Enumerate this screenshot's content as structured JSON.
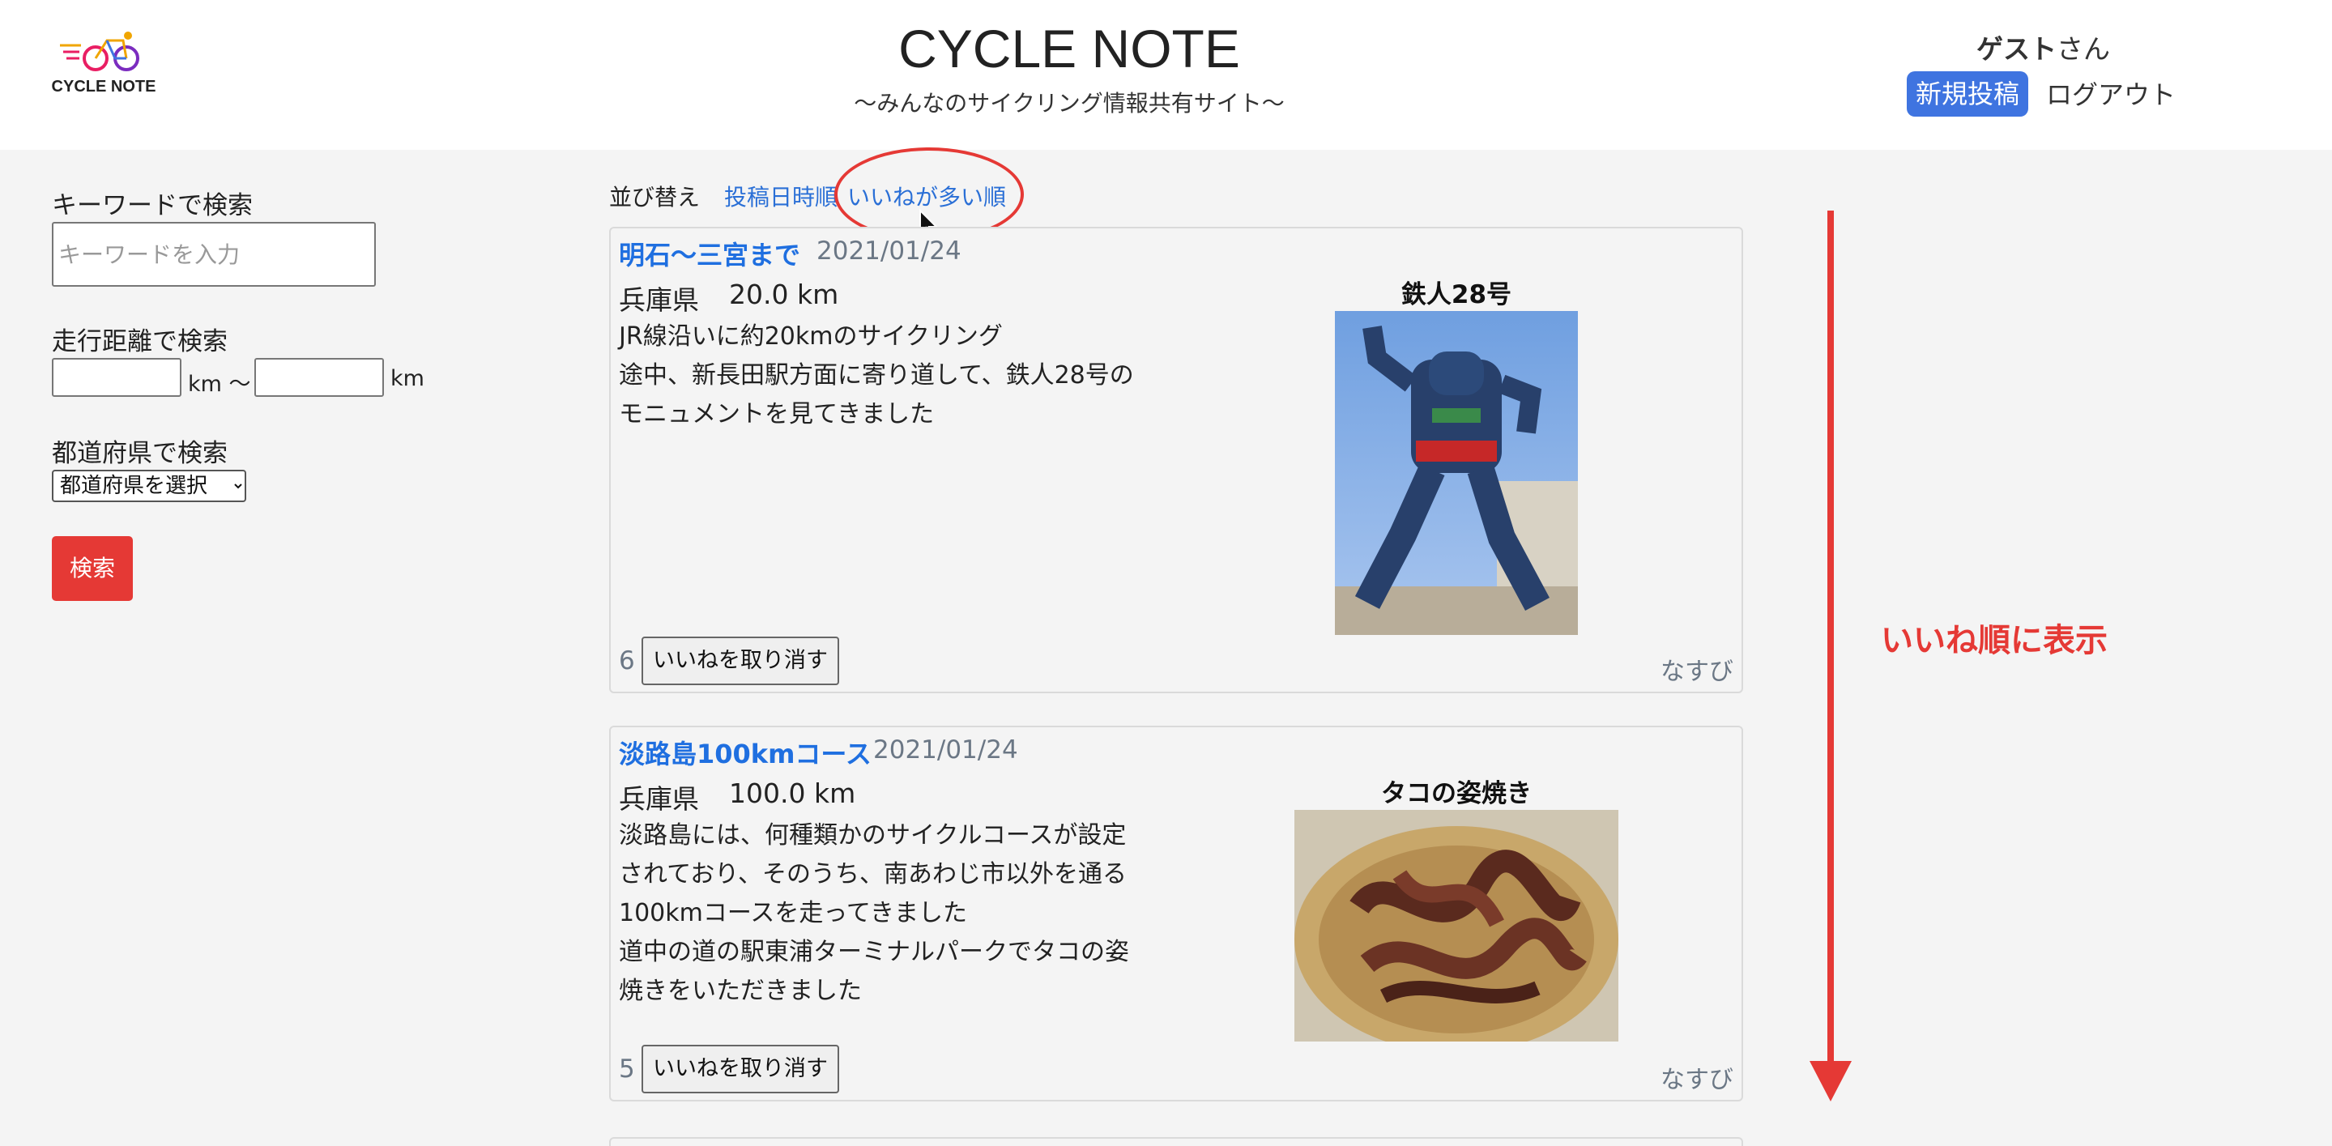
{
  "header": {
    "logo_text": "CYCLE NOTE",
    "title": "CYCLE NOTE",
    "subtitle": "〜みんなのサイクリング情報共有サイト〜",
    "user_name": "ゲスト",
    "user_suffix": "さん",
    "new_post_label": "新規投稿",
    "logout_label": "ログアウト"
  },
  "sidebar": {
    "keyword_label": "キーワードで検索",
    "keyword_placeholder": "キーワードを入力",
    "distance_label": "走行距離で検索",
    "km_unit": "km",
    "km_separator": "km 〜",
    "prefecture_label": "都道府県で検索",
    "prefecture_selected": "都道府県を選択",
    "search_label": "検索"
  },
  "sort": {
    "label": "並び替え",
    "by_date": "投稿日時順",
    "by_likes": "いいねが多い順"
  },
  "posts": [
    {
      "title": "明石〜三宮まで",
      "date": "2021/01/24",
      "prefecture": "兵庫県",
      "distance": "20.0  km",
      "body": [
        "JR線沿いに約20kmのサイクリング",
        "途中、新長田駅方面に寄り道して、鉄人28号の",
        "モニュメントを見てきました"
      ],
      "image_title": "鉄人28号",
      "likes": "6",
      "unlike_label": "いいねを取り消す",
      "author": "なすび"
    },
    {
      "title": "淡路島100kmコース",
      "date": "2021/01/24",
      "prefecture": "兵庫県",
      "distance": "100.0  km",
      "body": [
        "淡路島には、何種類かのサイクルコースが設定",
        "されており、そのうち、南あわじ市以外を通る",
        "100kmコースを走ってきました",
        "道中の道の駅東浦ターミナルパークでタコの姿",
        "焼きをいただきました"
      ],
      "image_title": "タコの姿焼き",
      "likes": "5",
      "unlike_label": "いいねを取り消す",
      "author": "なすび"
    }
  ],
  "annotation": {
    "text": "いいね順に表示"
  },
  "colors": {
    "accent_red": "#e53935",
    "link_blue": "#2a6fd6",
    "button_blue": "#3f74e0"
  }
}
